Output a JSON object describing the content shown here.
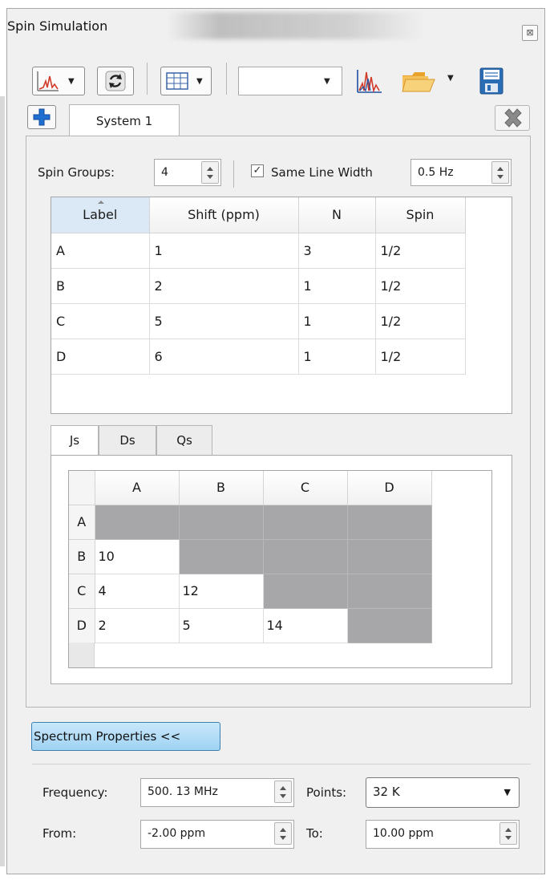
{
  "window": {
    "title": "Spin Simulation",
    "close_glyph": "⊠"
  },
  "toolbar": {
    "preset_value": "",
    "icons": [
      "spectrum-chart-icon",
      "refresh-icon",
      "table-grid-icon",
      "peaks-chart-icon",
      "folder-open-icon",
      "save-icon"
    ],
    "dropdown_arrow": "▼"
  },
  "tabs": {
    "system_label": "System 1",
    "add_glyph": "✚",
    "remove_glyph": "✖"
  },
  "system": {
    "spin_groups_label": "Spin Groups:",
    "spin_groups_value": "4",
    "same_line_width_label": "Same Line Width",
    "same_line_width_checked": true,
    "line_width_value": "0.5 Hz"
  },
  "spin_table": {
    "columns": [
      "Label",
      "Shift (ppm)",
      "N",
      "Spin"
    ],
    "rows": [
      [
        "A",
        "1",
        "3",
        "1/2"
      ],
      [
        "B",
        "2",
        "1",
        "1/2"
      ],
      [
        "C",
        "5",
        "1",
        "1/2"
      ],
      [
        "D",
        "6",
        "1",
        "1/2"
      ]
    ]
  },
  "coupling": {
    "tabs": [
      "Js",
      "Ds",
      "Qs"
    ],
    "active_tab": "Js",
    "columns": [
      "A",
      "B",
      "C",
      "D"
    ],
    "rows": [
      {
        "label": "A",
        "cells": [
          "",
          "",
          "",
          ""
        ]
      },
      {
        "label": "B",
        "cells": [
          "10",
          "",
          "",
          ""
        ]
      },
      {
        "label": "C",
        "cells": [
          "4",
          "12",
          "",
          ""
        ]
      },
      {
        "label": "D",
        "cells": [
          "2",
          "5",
          "14",
          ""
        ]
      }
    ]
  },
  "spectrum": {
    "toggle_label": "Spectrum Properties <<",
    "frequency_label": "Frequency:",
    "frequency_value": "500. 13 MHz",
    "points_label": "Points:",
    "points_value": "32 K",
    "from_label": "From:",
    "from_value": "-2.00 ppm",
    "to_label": "To:",
    "to_value": "10.00 ppm"
  },
  "colors": {
    "accent": "#3c7fb1",
    "locked_cell": "#a7a7a9",
    "save_blue": "#2a6db5",
    "folder_orange": "#f2b034",
    "spectrum_red": "#d23a2a"
  }
}
